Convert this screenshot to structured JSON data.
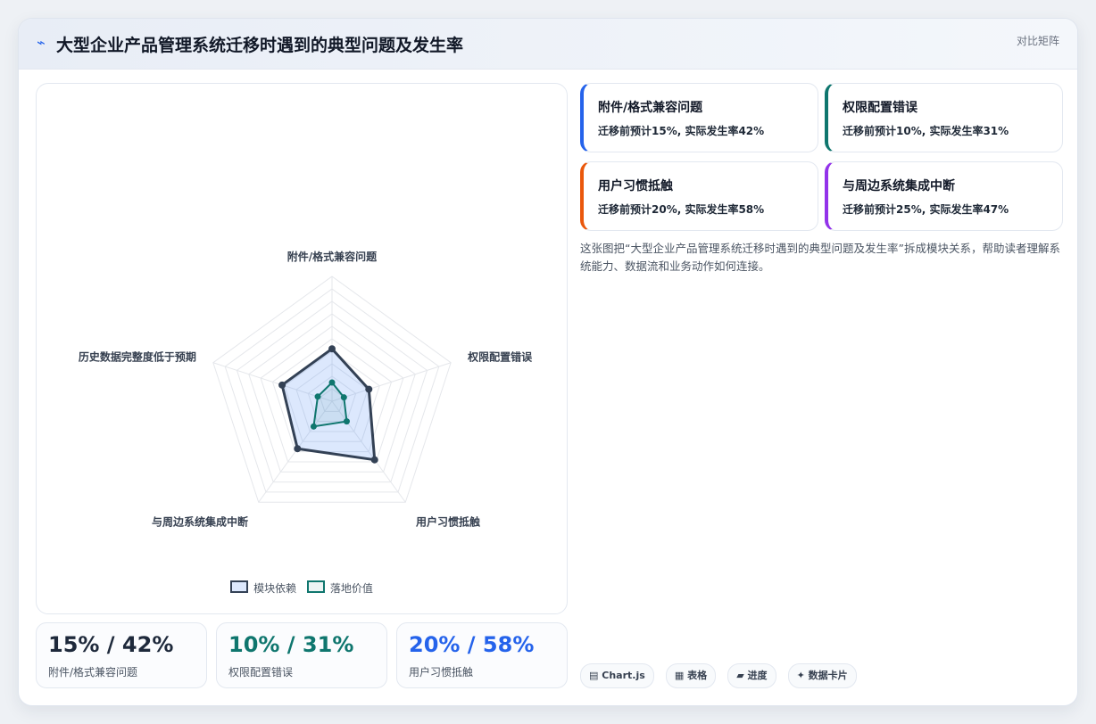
{
  "header": {
    "title": "大型企业产品管理系统迁移时遇到的典型问题及发生率",
    "tag": "对比矩阵",
    "icon": "bolt-icon"
  },
  "chart_data": {
    "type": "radar",
    "axes": [
      "附件/格式兼容问题",
      "权限配置错误",
      "用户习惯抵触",
      "与周边系统集成中断",
      "历史数据完整度低于预期"
    ],
    "series": [
      {
        "name": "模块依赖",
        "values": [
          42,
          31,
          58,
          47,
          42
        ],
        "color": "#334155"
      },
      {
        "name": "落地价值",
        "values": [
          15,
          10,
          20,
          25,
          12
        ],
        "color": "#0f766e"
      }
    ],
    "range": [
      0,
      100
    ],
    "grid_levels": 10,
    "legend_position": "bottom"
  },
  "stats": [
    {
      "value": "15% / 42%",
      "label": "附件/格式兼容问题",
      "color": "#1e293b"
    },
    {
      "value": "10% / 31%",
      "label": "权限配置错误",
      "color": "#0f766e"
    },
    {
      "value": "20% / 58%",
      "label": "用户习惯抵触",
      "color": "#2563eb"
    }
  ],
  "cards": [
    {
      "title": "附件/格式兼容问题",
      "desc": "迁移前预计15%, 实际发生率42%",
      "accent": "#2563eb"
    },
    {
      "title": "权限配置错误",
      "desc": "迁移前预计10%, 实际发生率31%",
      "accent": "#0f766e"
    },
    {
      "title": "用户习惯抵触",
      "desc": "迁移前预计20%, 实际发生率58%",
      "accent": "#ea580c"
    },
    {
      "title": "与周边系统集成中断",
      "desc": "迁移前预计25%, 实际发生率47%",
      "accent": "#9333ea"
    }
  ],
  "description": "这张图把“大型企业产品管理系统迁移时遇到的典型问题及发生率”拆成模块关系，帮助读者理解系统能力、数据流和业务动作如何连接。",
  "chips": [
    {
      "icon": "▤",
      "label": "Chart.js"
    },
    {
      "icon": "▦",
      "label": "表格"
    },
    {
      "icon": "▰",
      "label": "进度"
    },
    {
      "icon": "✦",
      "label": "数据卡片"
    }
  ]
}
